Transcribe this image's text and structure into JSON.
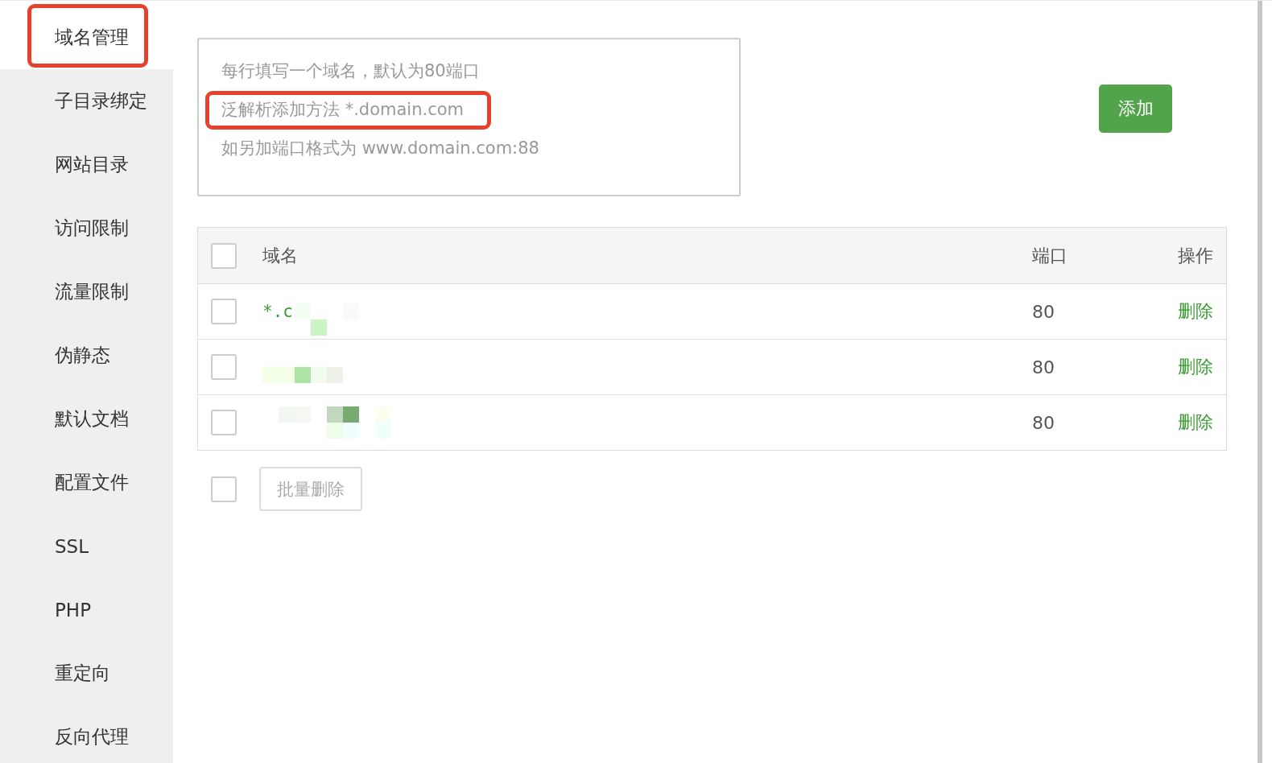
{
  "sidebar": {
    "items": [
      {
        "label": "域名管理",
        "selected": true,
        "highlighted": true
      },
      {
        "label": "子目录绑定",
        "selected": false,
        "highlighted": false
      },
      {
        "label": "网站目录",
        "selected": false,
        "highlighted": false
      },
      {
        "label": "访问限制",
        "selected": false,
        "highlighted": false
      },
      {
        "label": "流量限制",
        "selected": false,
        "highlighted": false
      },
      {
        "label": "伪静态",
        "selected": false,
        "highlighted": false
      },
      {
        "label": "默认文档",
        "selected": false,
        "highlighted": false
      },
      {
        "label": "配置文件",
        "selected": false,
        "highlighted": false
      },
      {
        "label": "SSL",
        "selected": false,
        "highlighted": false
      },
      {
        "label": "PHP",
        "selected": false,
        "highlighted": false
      },
      {
        "label": "重定向",
        "selected": false,
        "highlighted": false
      },
      {
        "label": "反向代理",
        "selected": false,
        "highlighted": false
      }
    ]
  },
  "domain_input": {
    "placeholder_lines": [
      {
        "text": "每行填写一个域名，默认为80端口",
        "highlighted": false
      },
      {
        "text": "泛解析添加方法 *.domain.com",
        "highlighted": true
      },
      {
        "text": "如另加端口格式为 www.domain.com:88",
        "highlighted": false
      }
    ]
  },
  "add_button": "添加",
  "table": {
    "columns": [
      "域名",
      "端口",
      "操作"
    ],
    "header_checked": false,
    "rows": [
      {
        "domain": "*.c",
        "redacted": true,
        "port": "80",
        "action": "删除",
        "checked": false
      },
      {
        "redacted": true,
        "port": "80",
        "action": "删除",
        "checked": false
      },
      {
        "redacted": true,
        "port": "80",
        "action": "删除",
        "checked": false
      }
    ]
  },
  "footer": {
    "checked": false,
    "batch_button": "批量删除"
  }
}
